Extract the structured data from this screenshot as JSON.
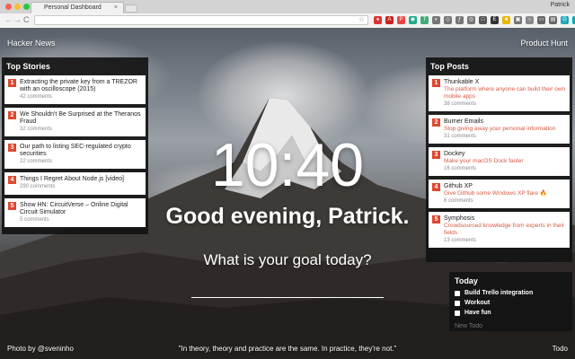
{
  "browser": {
    "tab_title": "Personal Dashboard",
    "tab_close": "×",
    "user_name": "Patrick",
    "back_glyph": "←",
    "forward_glyph": "→",
    "reload_glyph": "C",
    "star_glyph": "☆",
    "menu_glyph": "⋮",
    "extensions": [
      {
        "name": "record-ext-icon",
        "glyph": "●",
        "color": "#d33"
      },
      {
        "name": "adblock-ext-icon",
        "glyph": "A",
        "color": "#c22"
      },
      {
        "name": "pocket-ext-icon",
        "glyph": "P",
        "color": "#e44"
      },
      {
        "name": "chrome-ext-icon",
        "glyph": "◉",
        "color": "#2a8"
      },
      {
        "name": "translate-ext-icon",
        "glyph": "T",
        "color": "#4a7"
      },
      {
        "name": "color-ext-icon",
        "glyph": "◐",
        "color": "#777"
      },
      {
        "name": "tag-ext-icon",
        "glyph": "◇",
        "color": "#777"
      },
      {
        "name": "font-ext-icon",
        "glyph": "ƒ",
        "color": "#777"
      },
      {
        "name": "eye-ext-icon",
        "glyph": "◎",
        "color": "#777"
      },
      {
        "name": "square-ext-icon",
        "glyph": "□",
        "color": "#555"
      },
      {
        "name": "evernote-ext-icon",
        "glyph": "E",
        "color": "#333"
      },
      {
        "name": "note-ext-icon",
        "glyph": "■",
        "color": "#e9b400"
      },
      {
        "name": "gallery-ext-icon",
        "glyph": "▣",
        "color": "#777"
      },
      {
        "name": "circle-ext-icon",
        "glyph": "○",
        "color": "#888"
      },
      {
        "name": "window-ext-icon",
        "glyph": "▭",
        "color": "#666"
      },
      {
        "name": "layers-ext-icon",
        "glyph": "▤",
        "color": "#666"
      },
      {
        "name": "grammarly-ext-icon",
        "glyph": "G",
        "color": "#2ab"
      },
      {
        "name": "sync-ext-icon",
        "glyph": "↻",
        "color": "#0aa"
      },
      {
        "name": "panel-ext-icon",
        "glyph": "▥",
        "color": "#777"
      },
      {
        "name": "dashboard-ext-icon",
        "glyph": "▦",
        "color": "#c66"
      }
    ]
  },
  "links": {
    "left": "Hacker News",
    "right": "Product Hunt"
  },
  "hacker_news": {
    "title": "Top Stories",
    "items": [
      {
        "num": "1",
        "title": "Extracting the private key from a TREZOR with an oscilloscope (2015)",
        "meta": "42 comments"
      },
      {
        "num": "2",
        "title": "We Shouldn't Be Surprised at the Theranos Fraud",
        "meta": "32 comments"
      },
      {
        "num": "3",
        "title": "Our path to listing SEC-regulated crypto securities",
        "meta": "22 comments"
      },
      {
        "num": "4",
        "title": "Things I Regret About Node.js [video]",
        "meta": "290 comments"
      },
      {
        "num": "5",
        "title": "Show HN: CircuitVerse – Online Digital Circuit Simulator",
        "meta": "5 comments"
      }
    ]
  },
  "product_hunt": {
    "title": "Top Posts",
    "items": [
      {
        "num": "1",
        "title": "Thunkable X",
        "desc": "The platform where anyone can build their own mobile apps",
        "meta": "38 comments"
      },
      {
        "num": "2",
        "title": "Burner Emails",
        "desc": "Stop giving away your personal information",
        "meta": "31 comments"
      },
      {
        "num": "3",
        "title": "Dockey",
        "desc": "Make your macOS Dock faster",
        "meta": "16 comments"
      },
      {
        "num": "4",
        "title": "Github XP",
        "desc": "Give Github some Windows XP flare 🔥",
        "meta": "6 comments"
      },
      {
        "num": "5",
        "title": "Symphosis",
        "desc": "Crowdsourced knowledge from experts in their fields",
        "meta": "13 comments"
      }
    ]
  },
  "center": {
    "time": "10:40",
    "greeting": "Good evening, Patrick.",
    "goal_question": "What is your goal today?"
  },
  "todo": {
    "title": "Today",
    "items": [
      {
        "label": "Build Trello integration"
      },
      {
        "label": "Workout"
      },
      {
        "label": "Have fun"
      }
    ],
    "new_placeholder": "New Todo"
  },
  "footer": {
    "photo_credit": "Photo by @sveninho",
    "quote": "\"In theory, theory and practice are the same. In practice, they're not.\"",
    "todo_link": "Todo"
  },
  "colors": {
    "accent": "#e0472f",
    "panel": "#141414"
  }
}
